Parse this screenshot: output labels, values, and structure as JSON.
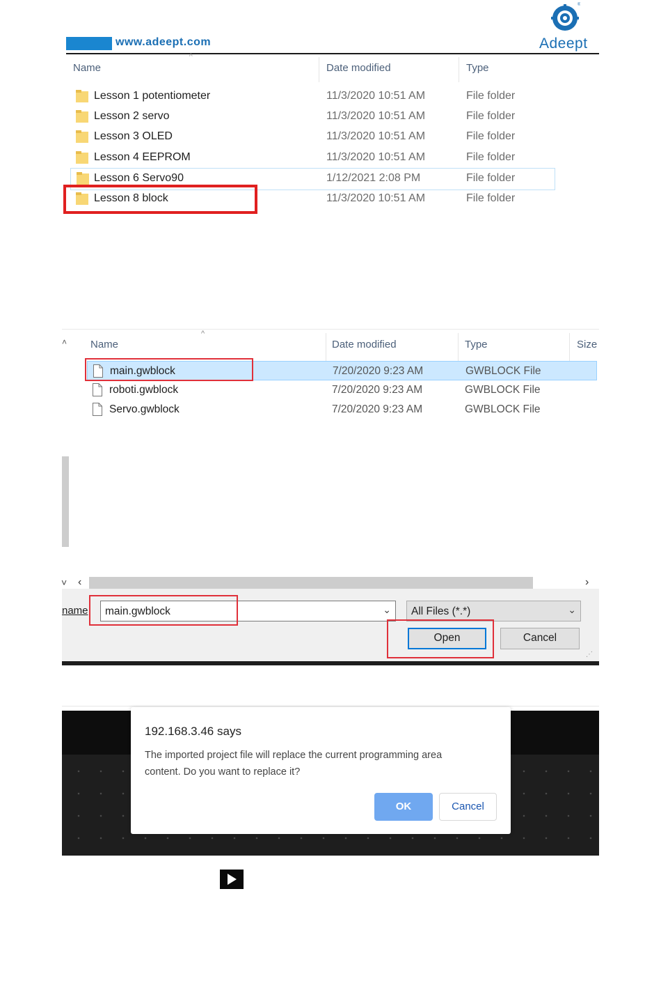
{
  "header": {
    "url": "www.adeept.com",
    "brand": "Adeept",
    "brand_color": "#1b6fb4",
    "accent_bar_color": "#1a86d0"
  },
  "explorer": {
    "columns": [
      "Name",
      "Date modified",
      "Type"
    ],
    "sort_icon": "chevron-up-icon",
    "rows": [
      {
        "name": "Lesson 1 potentiometer",
        "date": "11/3/2020 10:51 AM",
        "type": "File folder"
      },
      {
        "name": "Lesson 2 servo",
        "date": "11/3/2020 10:51 AM",
        "type": "File folder"
      },
      {
        "name": "Lesson 3 OLED",
        "date": "11/3/2020 10:51 AM",
        "type": "File folder"
      },
      {
        "name": "Lesson 4 EEPROM",
        "date": "11/3/2020 10:51 AM",
        "type": "File folder"
      },
      {
        "name": "Lesson 6 Servo90",
        "date": "1/12/2021 2:08 PM",
        "type": "File folder"
      },
      {
        "name": "Lesson 8 block",
        "date": "11/3/2020 10:51 AM",
        "type": "File folder"
      }
    ],
    "highlight_color": "#e02020"
  },
  "file_dialog": {
    "columns": [
      "Name",
      "Date modified",
      "Type",
      "Size"
    ],
    "files": [
      {
        "name": "main.gwblock",
        "date": "7/20/2020 9:23 AM",
        "type": "GWBLOCK File"
      },
      {
        "name": "roboti.gwblock",
        "date": "7/20/2020 9:23 AM",
        "type": "GWBLOCK File"
      },
      {
        "name": "Servo.gwblock",
        "date": "7/20/2020 9:23 AM",
        "type": "GWBLOCK File"
      }
    ],
    "filename_label": "name",
    "filename_value": "main.gwblock",
    "filter_value": "All Files (*.*)",
    "open_label": "Open",
    "cancel_label": "Cancel"
  },
  "confirm_dialog": {
    "title": "192.168.3.46 says",
    "message_line1": "The imported project file will replace the current programming area",
    "message_line2": "content. Do you want to replace it?",
    "ok_label": "OK",
    "cancel_label": "Cancel",
    "ok_color": "#70a8f0"
  },
  "play_icon": "play-icon"
}
